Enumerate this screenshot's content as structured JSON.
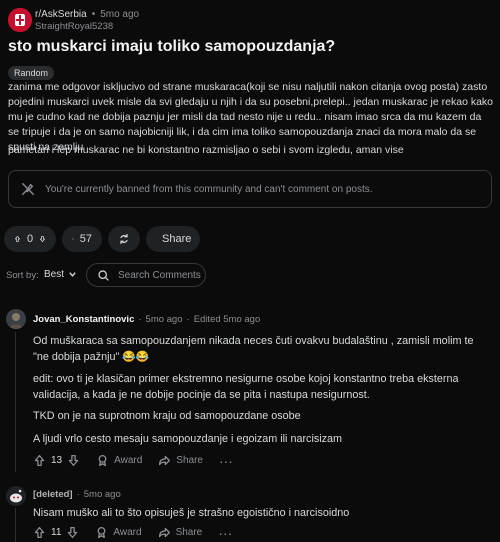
{
  "post": {
    "subreddit": "r/AskSerbia",
    "age": "5mo ago",
    "author": "StraightRoyal5238",
    "title": "sto muskarci imaju toliko samopouzdanja?",
    "flair": "Random",
    "paragraph1": "zanima me odgovor iskljucivo od strane muskaraca(koji se nisu naljutili nakon citanja ovog posta) zasto pojedini muskarci uvek misle da svi gledaju u njih i da su posebni,prelepi.. jedan muskarac je rekao kako mu je cudno kad ne dobija paznju jer misli da tad nesto nije u redu.. nisam imao srca da mu kazem da se tripuje i da je on samo najobicniji lik, i da cim ima toliko samopouzdanja znaci da mora malo da se spusti na zemlju",
    "paragraph2": "pametan i lep muskarac ne bi konstantno razmisljao o sebi i svom izgledu, aman vise",
    "banned_notice": "You're currently banned from this community and can't comment on posts.",
    "votes": "0",
    "comments": "57",
    "share_label": "Share"
  },
  "sort": {
    "label": "Sort by:",
    "value": "Best",
    "search_placeholder": "Search Comments"
  },
  "comments": [
    {
      "author": "Jovan_Konstantinovic",
      "age": "5mo ago",
      "edited": "Edited 5mo ago",
      "p1": "Od muškaraca sa samopouzdanjem nikada neces čuti ovakvu budalaštinu , zamisli molim te \"ne dobija pažnju\" 😂😂",
      "p2": "edit: ovo ti je klasičan primer ekstremno nesigurne osobe kojoj konstantno treba eksterna validacija, a kada je ne dobije pocinje da se pita i nastupa nesigurnost.",
      "p3": "TKD on je na suprotnom kraju od samopouzdane osobe",
      "p4": "A ljudi vrlo cesto mesaju samopouzdanje i egoizam ili narcisizam",
      "votes": "13",
      "award": "Award",
      "share": "Share"
    },
    {
      "author": "[deleted]",
      "age": "5mo ago",
      "p1": "Nisam muško ali to što opisuješ je strašno egoistično i narcisoidno",
      "votes": "11",
      "award": "Award",
      "share": "Share"
    }
  ],
  "colors": {
    "background": "#0b0b0c",
    "pill": "#1f2224",
    "subreddit_avatar": "#c8102e"
  }
}
